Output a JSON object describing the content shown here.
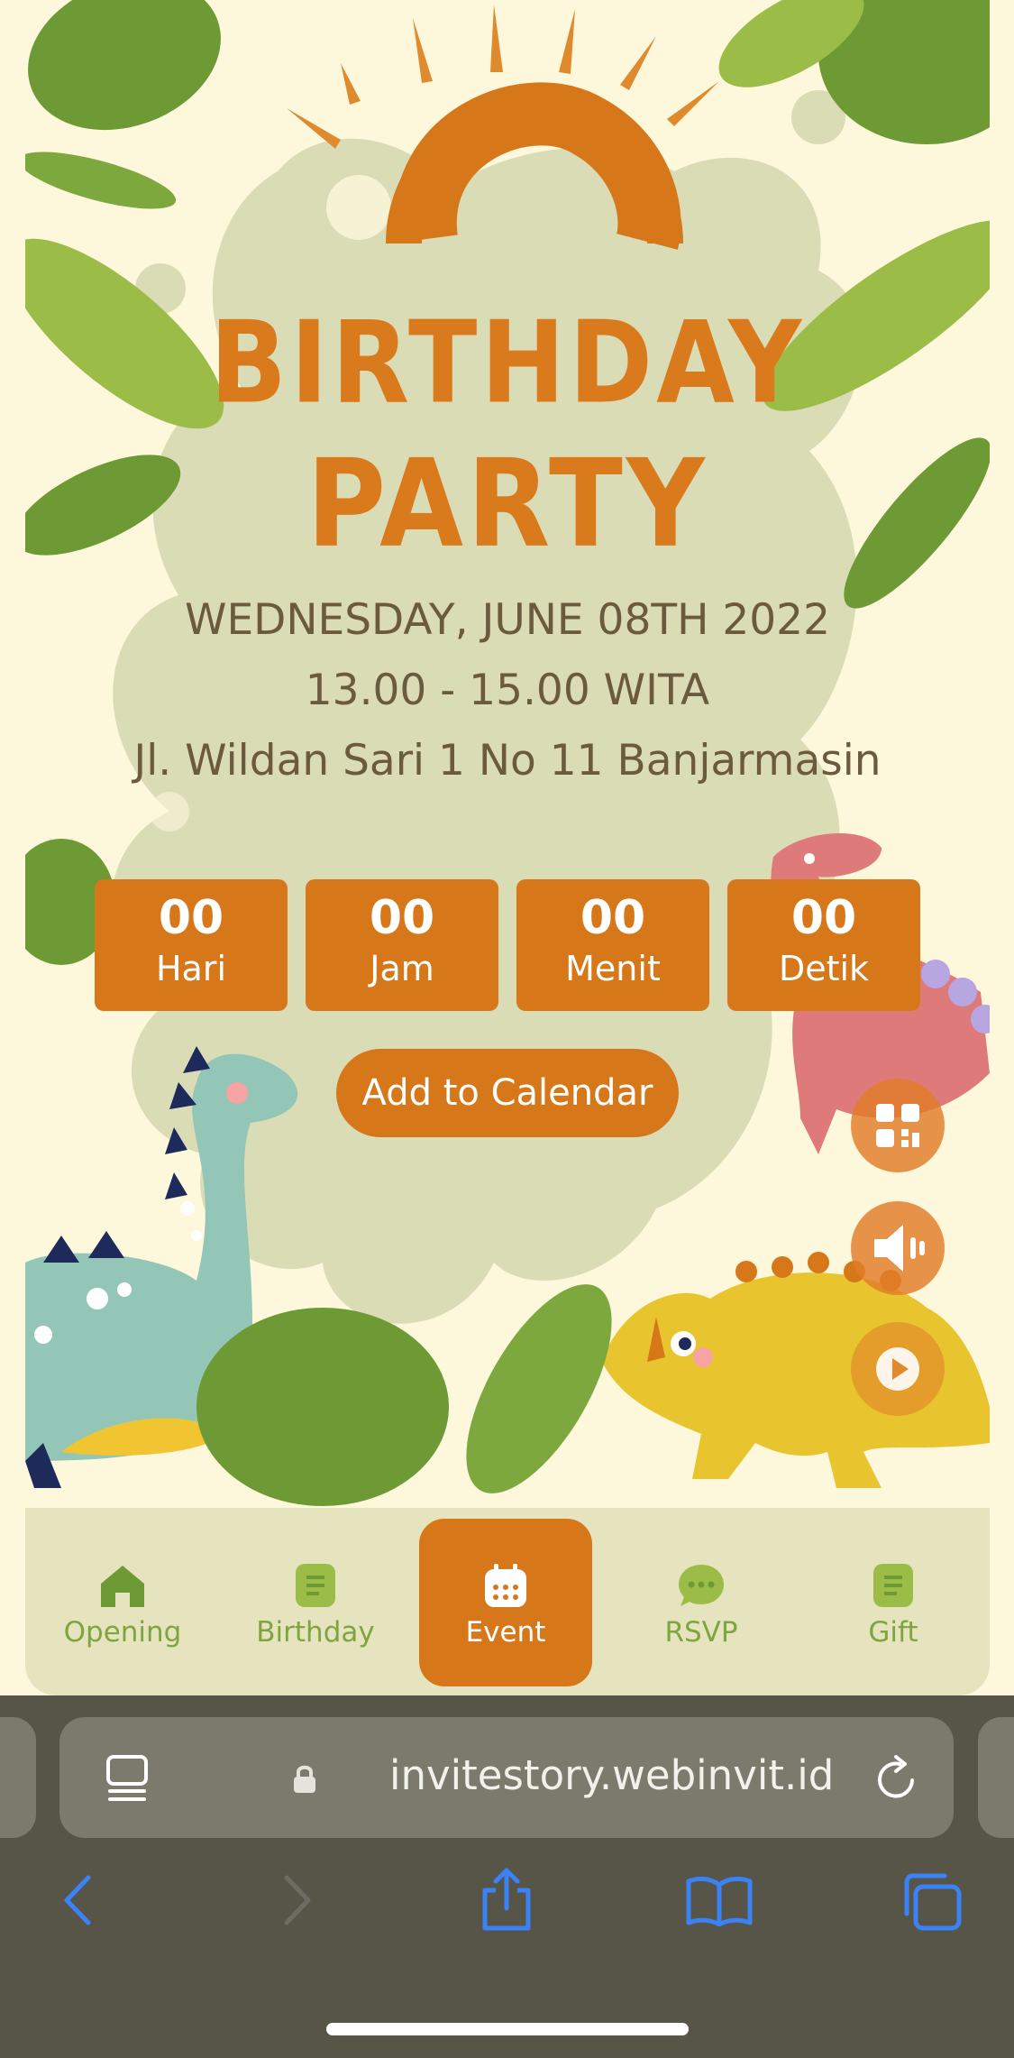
{
  "invitation": {
    "title_line1": "BIRTHDAY",
    "title_line2": "PARTY",
    "date": "WEDNESDAY, JUNE 08TH 2022",
    "time": "13.00 - 15.00 WITA",
    "address": "Jl. Wildan Sari 1 No 11 Banjarmasin"
  },
  "countdown": [
    {
      "value": "00",
      "label": "Hari"
    },
    {
      "value": "00",
      "label": "Jam"
    },
    {
      "value": "00",
      "label": "Menit"
    },
    {
      "value": "00",
      "label": "Detik"
    }
  ],
  "calendar_button": "Add to Calendar",
  "floating_buttons": [
    {
      "icon": "qr-code-icon"
    },
    {
      "icon": "speaker-icon"
    },
    {
      "icon": "play-icon"
    }
  ],
  "nav": {
    "tabs": [
      {
        "label": "Opening",
        "icon": "home-icon",
        "active": false
      },
      {
        "label": "Birthday",
        "icon": "document-icon",
        "active": false
      },
      {
        "label": "Event",
        "icon": "calendar-icon",
        "active": true
      },
      {
        "label": "RSVP",
        "icon": "chat-icon",
        "active": false
      },
      {
        "label": "Gift",
        "icon": "document-icon",
        "active": false
      }
    ]
  },
  "browser": {
    "url": "invitestory.webinvit.id",
    "toolbar_icons": [
      "back-icon",
      "forward-icon",
      "share-icon",
      "bookmarks-icon",
      "tabs-icon"
    ]
  },
  "colors": {
    "accent": "#d6781a",
    "background": "#fdf7dc",
    "blob": "#dadcb6",
    "nav_bg": "#e6e4be",
    "nav_text": "#7fa540",
    "chrome": "#575548",
    "ios_blue": "#3b82f6"
  }
}
